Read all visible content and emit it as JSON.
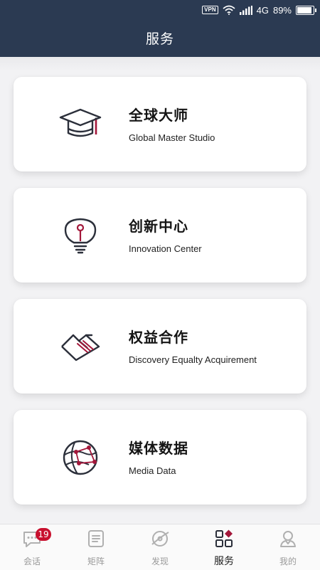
{
  "status_bar": {
    "vpn_label": "VPN",
    "network": "4G",
    "battery": "89%",
    "battery_level": 0.89
  },
  "header": {
    "title": "服务"
  },
  "cards": [
    {
      "title": "全球大师",
      "subtitle": "Global Master Studio",
      "icon": "graduation-cap-icon"
    },
    {
      "title": "创新中心",
      "subtitle": "Innovation Center",
      "icon": "lightbulb-icon"
    },
    {
      "title": "权益合作",
      "subtitle": "Discovery Equalty Acquirement",
      "icon": "handshake-icon"
    },
    {
      "title": "媒体数据",
      "subtitle": "Media Data",
      "icon": "globe-network-icon"
    }
  ],
  "tabbar": {
    "items": [
      {
        "label": "会话",
        "icon": "chat-bubble-icon",
        "badge": "19"
      },
      {
        "label": "矩阵",
        "icon": "document-list-icon"
      },
      {
        "label": "发现",
        "icon": "compass-icon"
      },
      {
        "label": "服务",
        "icon": "grid-apps-icon",
        "active": true
      },
      {
        "label": "我的",
        "icon": "user-profile-icon"
      }
    ]
  },
  "colors": {
    "header_bg": "#2b3a52",
    "accent": "#a3173a",
    "icon_stroke": "#2b2f3a",
    "badge": "#c8102e"
  }
}
